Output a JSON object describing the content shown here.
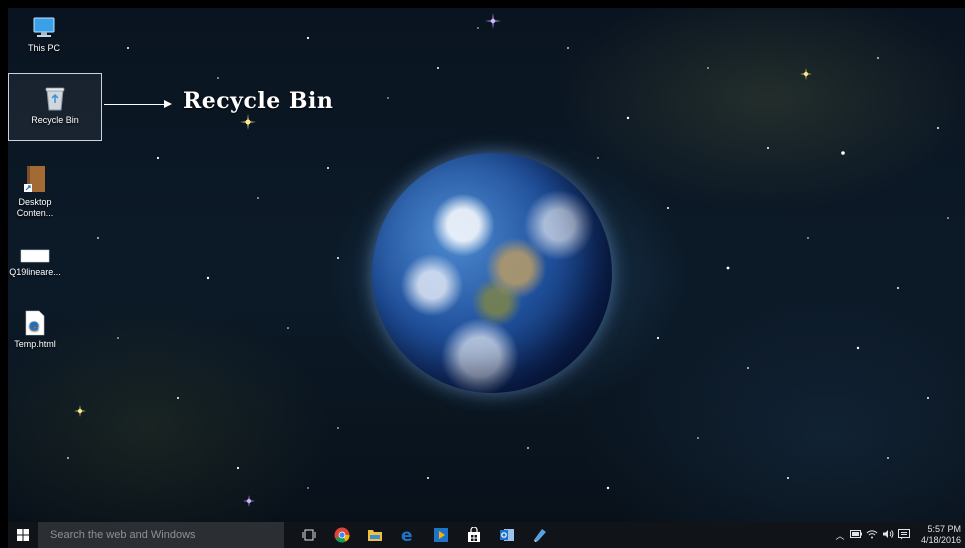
{
  "desktop": {
    "icons": [
      {
        "label": "This PC",
        "icon": "this-pc-icon"
      },
      {
        "label": "Recycle Bin",
        "icon": "recycle-bin-icon"
      },
      {
        "label": "Desktop Conten...",
        "icon": "desktop-content-folder-icon"
      },
      {
        "label": "Q19lineare...",
        "icon": "document-thumbnail-icon"
      },
      {
        "label": "Temp.html",
        "icon": "edge-html-file-icon"
      }
    ],
    "callout": "Recycle Bin"
  },
  "taskbar": {
    "search_placeholder": "Search the web and Windows",
    "apps": [
      "task-view-icon",
      "chrome-icon",
      "file-explorer-icon",
      "edge-icon",
      "media-player-icon",
      "store-icon",
      "outlook-icon",
      "pen-app-icon"
    ],
    "tray": {
      "icons": [
        "chevron-up-icon",
        "battery-icon",
        "wifi-icon",
        "volume-icon",
        "action-center-icon"
      ],
      "time": "5:57 PM",
      "date": "4/18/2016"
    }
  },
  "colors": {
    "taskbar_bg": "#101418",
    "search_bg": "#2b2f33",
    "edge_blue": "#1e73c8"
  }
}
